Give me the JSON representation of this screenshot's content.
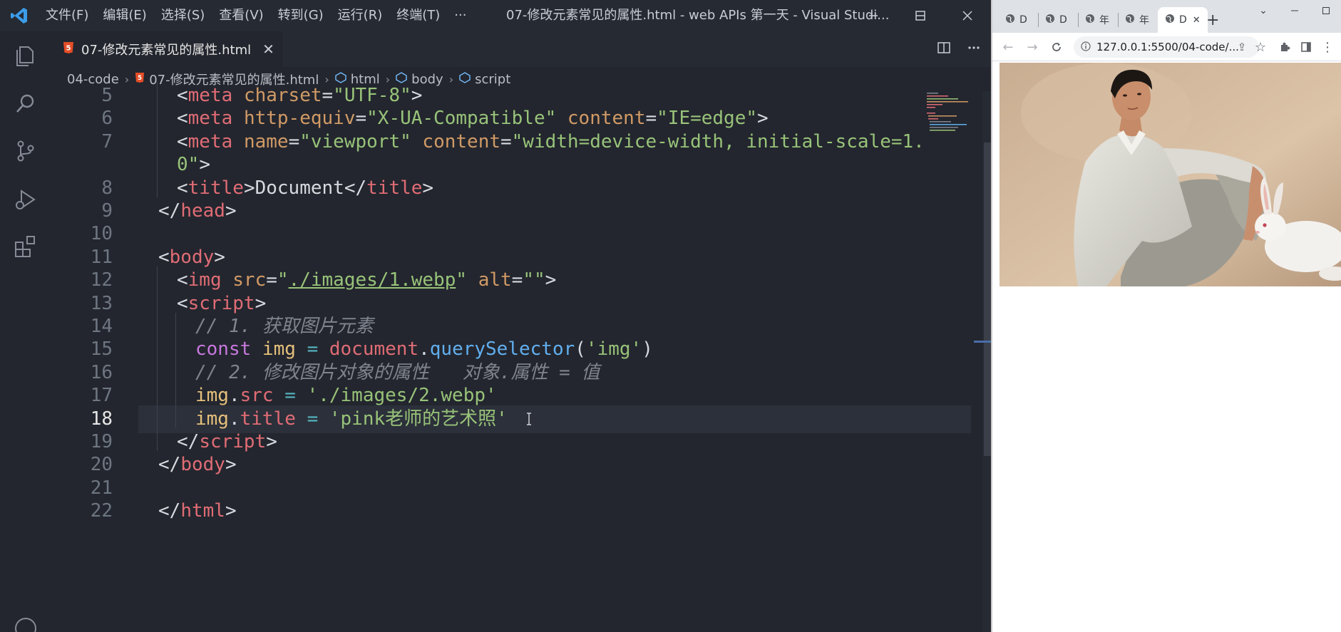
{
  "vscode": {
    "menu": [
      "文件(F)",
      "编辑(E)",
      "选择(S)",
      "查看(V)",
      "转到(G)",
      "运行(R)",
      "终端(T)",
      "···"
    ],
    "window_title": "07-修改元素常见的属性.html - web APIs 第一天 - Visual Studi...",
    "tab": {
      "label": "07-修改元素常见的属性.html",
      "close": "✕"
    },
    "breadcrumb": [
      "04-code",
      "07-修改元素常见的属性.html",
      "html",
      "body",
      "script"
    ],
    "active_line": 18,
    "lines": [
      {
        "n": "5",
        "tokens": [
          [
            "punc",
            "<"
          ],
          [
            "tag",
            "meta"
          ],
          [
            "text",
            " "
          ],
          [
            "attr",
            "charset"
          ],
          [
            "punc",
            "="
          ],
          [
            "str",
            "\"UTF-8\""
          ],
          [
            "punc",
            ">"
          ]
        ]
      },
      {
        "n": "6",
        "tokens": [
          [
            "punc",
            "<"
          ],
          [
            "tag",
            "meta"
          ],
          [
            "text",
            " "
          ],
          [
            "attr",
            "http-equiv"
          ],
          [
            "punc",
            "="
          ],
          [
            "str",
            "\"X-UA-Compatible\""
          ],
          [
            "text",
            " "
          ],
          [
            "attr",
            "content"
          ],
          [
            "punc",
            "="
          ],
          [
            "str",
            "\"IE=edge\""
          ],
          [
            "punc",
            ">"
          ]
        ]
      },
      {
        "n": "7",
        "tokens": [
          [
            "punc",
            "<"
          ],
          [
            "tag",
            "meta"
          ],
          [
            "text",
            " "
          ],
          [
            "attr",
            "name"
          ],
          [
            "punc",
            "="
          ],
          [
            "str",
            "\"viewport\""
          ],
          [
            "text",
            " "
          ],
          [
            "attr",
            "content"
          ],
          [
            "punc",
            "="
          ],
          [
            "str",
            "\"width=device-width, initial-scale=1."
          ]
        ]
      },
      {
        "n": "",
        "tokens": [
          [
            "str",
            "0\""
          ],
          [
            "punc",
            ">"
          ]
        ]
      },
      {
        "n": "8",
        "tokens": [
          [
            "punc",
            "<"
          ],
          [
            "tag",
            "title"
          ],
          [
            "punc",
            ">"
          ],
          [
            "text",
            "Document"
          ],
          [
            "punc",
            "</"
          ],
          [
            "tag",
            "title"
          ],
          [
            "punc",
            ">"
          ]
        ]
      },
      {
        "n": "9",
        "tokens": [
          [
            "punc",
            "</"
          ],
          [
            "tag",
            "head"
          ],
          [
            "punc",
            ">"
          ]
        ]
      },
      {
        "n": "10",
        "tokens": []
      },
      {
        "n": "11",
        "tokens": [
          [
            "punc",
            "<"
          ],
          [
            "tag",
            "body"
          ],
          [
            "punc",
            ">"
          ]
        ]
      },
      {
        "n": "12",
        "tokens": [
          [
            "punc",
            "<"
          ],
          [
            "tag",
            "img"
          ],
          [
            "text",
            " "
          ],
          [
            "attr",
            "src"
          ],
          [
            "punc",
            "="
          ],
          [
            "str",
            "\""
          ],
          [
            "under",
            "./images/1.webp"
          ],
          [
            "str",
            "\""
          ],
          [
            "text",
            " "
          ],
          [
            "attr",
            "alt"
          ],
          [
            "punc",
            "="
          ],
          [
            "str",
            "\"\""
          ],
          [
            "punc",
            ">"
          ]
        ]
      },
      {
        "n": "13",
        "tokens": [
          [
            "punc",
            "<"
          ],
          [
            "tag",
            "script"
          ],
          [
            "punc",
            ">"
          ]
        ]
      },
      {
        "n": "14",
        "tokens": [
          [
            "cmt",
            "// 1. 获取图片元素"
          ]
        ]
      },
      {
        "n": "15",
        "tokens": [
          [
            "kw",
            "const"
          ],
          [
            "text",
            " "
          ],
          [
            "var",
            "img"
          ],
          [
            "text",
            " "
          ],
          [
            "op",
            "="
          ],
          [
            "text",
            " "
          ],
          [
            "prop",
            "document"
          ],
          [
            "text",
            "."
          ],
          [
            "fn",
            "querySelector"
          ],
          [
            "text",
            "("
          ],
          [
            "str",
            "'img'"
          ],
          [
            "text",
            ")"
          ]
        ]
      },
      {
        "n": "16",
        "tokens": [
          [
            "cmt",
            "// 2. 修改图片对象的属性   对象.属性 = 值"
          ]
        ]
      },
      {
        "n": "17",
        "tokens": [
          [
            "var",
            "img"
          ],
          [
            "text",
            "."
          ],
          [
            "prop",
            "src"
          ],
          [
            "text",
            " "
          ],
          [
            "op",
            "="
          ],
          [
            "text",
            " "
          ],
          [
            "str",
            "'./images/2.webp'"
          ]
        ]
      },
      {
        "n": "18",
        "tokens": [
          [
            "var",
            "img"
          ],
          [
            "text",
            "."
          ],
          [
            "prop",
            "title"
          ],
          [
            "text",
            " "
          ],
          [
            "op",
            "="
          ],
          [
            "text",
            " "
          ],
          [
            "str",
            "'pink老师的艺术照'"
          ]
        ]
      },
      {
        "n": "19",
        "tokens": [
          [
            "punc",
            "</"
          ],
          [
            "tag",
            "script"
          ],
          [
            "punc",
            ">"
          ]
        ]
      },
      {
        "n": "20",
        "tokens": [
          [
            "punc",
            "</"
          ],
          [
            "tag",
            "body"
          ],
          [
            "punc",
            ">"
          ]
        ]
      },
      {
        "n": "21",
        "tokens": []
      },
      {
        "n": "22",
        "tokens": [
          [
            "punc",
            "</"
          ],
          [
            "tag",
            "html"
          ],
          [
            "punc",
            ">"
          ]
        ]
      }
    ],
    "indent": [
      1,
      1,
      1,
      1,
      1,
      0,
      0,
      0,
      1,
      1,
      2,
      2,
      2,
      2,
      2,
      1,
      0,
      0,
      0
    ]
  },
  "browser": {
    "tabs": [
      "D",
      "D",
      "年",
      "年",
      "D"
    ],
    "active_tab_close": "✕",
    "new_tab": "+",
    "url": "127.0.0.1:5500/04-code/...",
    "photo_alt": ""
  },
  "colors": {
    "editor_bg": "#23262e",
    "keyword": "#c678dd",
    "string": "#98c379",
    "tag": "#e06c75",
    "attribute": "#d19a66",
    "comment": "#7f848e"
  }
}
